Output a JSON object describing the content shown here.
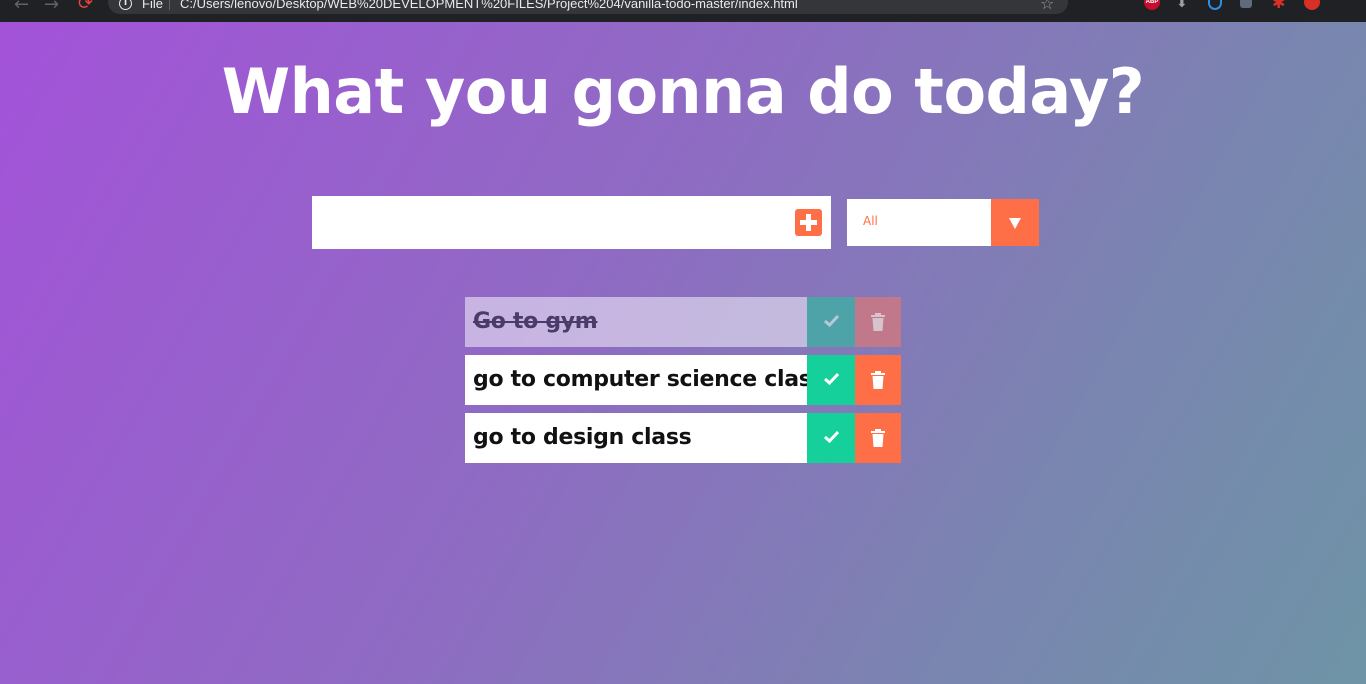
{
  "browser": {
    "scheme_label": "File",
    "url": "C:/Users/lenovo/Desktop/WEB%20DEVELOPMENT%20FILES/Project%204/vanilla-todo-master/index.html",
    "extensions": [
      "abp-icon",
      "download-icon",
      "shield-icon",
      "extension-icon",
      "puzzle-icon",
      "profile-icon"
    ],
    "abp_label": "ABP"
  },
  "app": {
    "title": "What you gonna do today?",
    "input": {
      "value": "",
      "placeholder": ""
    },
    "filter": {
      "selected": "All"
    },
    "todos": [
      {
        "text": "Go to gym",
        "completed": true
      },
      {
        "text": "go to computer science class",
        "completed": false
      },
      {
        "text": "go to design class",
        "completed": false
      }
    ]
  },
  "colors": {
    "accent": "#ff6f47",
    "check": "#15d09a",
    "gradient_start": "#a352d9",
    "gradient_end": "#6e94a6"
  }
}
